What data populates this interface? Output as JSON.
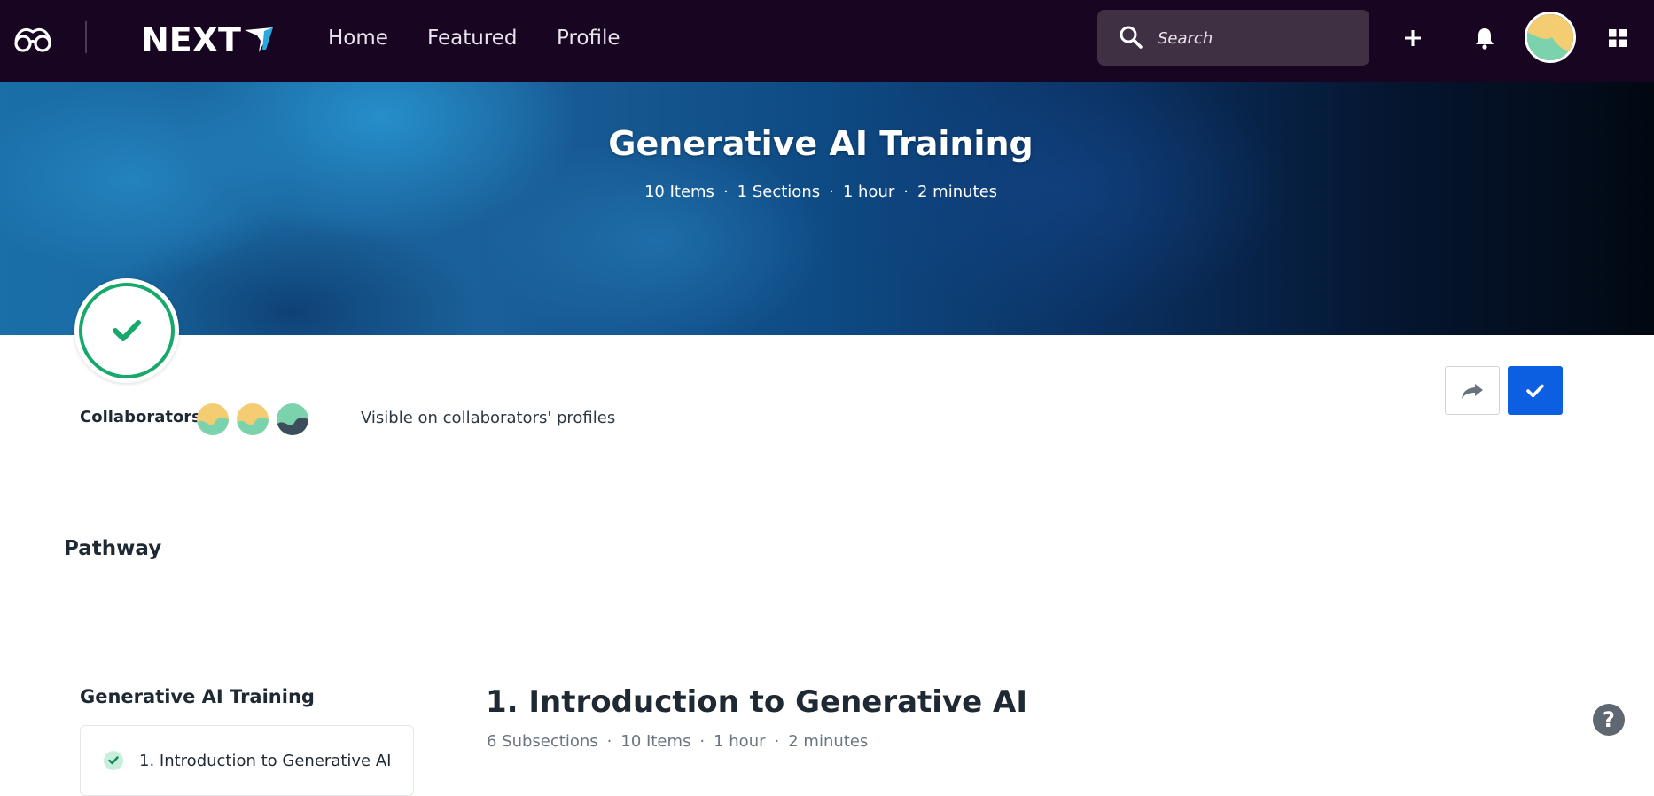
{
  "nav": {
    "links": [
      {
        "label": "Home"
      },
      {
        "label": "Featured"
      },
      {
        "label": "Profile"
      }
    ],
    "search": {
      "placeholder": "Search"
    },
    "icons": [
      "glasses-logo-icon",
      "search-icon",
      "plus-icon",
      "bell-icon",
      "avatar",
      "apps-grid-icon"
    ],
    "brand": {
      "text": "NEXT"
    }
  },
  "hero": {
    "title": "Generative AI Training",
    "meta": {
      "items": "10 Items",
      "sections": "1 Sections",
      "hours": "1 hour",
      "minutes": "2 minutes",
      "separator": "·"
    },
    "status": "completed"
  },
  "collaborators": {
    "label": "Collaborators:",
    "count": 3,
    "visibility": "Visible on collaborators' profiles"
  },
  "actions": {
    "share_icon": "share-arrow-icon",
    "complete_icon": "check-icon"
  },
  "pathway": {
    "heading": "Pathway",
    "outline": {
      "title": "Generative AI Training",
      "items": [
        {
          "label": "1. Introduction to Generative AI",
          "status": "completed"
        }
      ]
    },
    "section": {
      "title": "1. Introduction to Generative AI",
      "subsections": "6 Subsections",
      "items": "10 Items",
      "hours": "1 hour",
      "minutes": "2 minutes"
    }
  },
  "help": {
    "label": "?"
  },
  "colors": {
    "topbar": "#180521",
    "accent": "#0b5fe0",
    "success": "#17a86b"
  }
}
